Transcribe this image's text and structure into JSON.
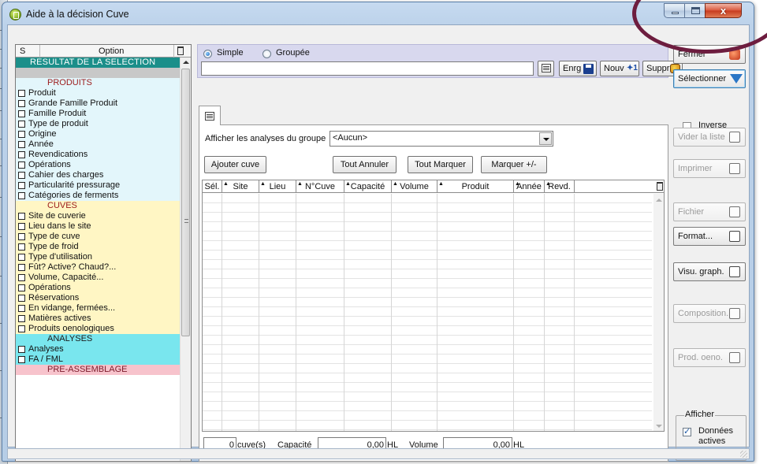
{
  "window": {
    "title": "Aide à la décision Cuve",
    "close_glyph": "x"
  },
  "options_panel": {
    "col_s": "S",
    "col_option": "Option",
    "rows": [
      {
        "label": "RESULTAT DE LA SELECTION",
        "kind": "selection-header"
      },
      {
        "label": "",
        "kind": "gray"
      },
      {
        "label": "PRODUITS",
        "kind": "section",
        "color": "#9b1b1b"
      },
      {
        "label": "Produit",
        "kind": "option"
      },
      {
        "label": "Grande Famille Produit",
        "kind": "option"
      },
      {
        "label": "Famille Produit",
        "kind": "option"
      },
      {
        "label": "Type de produit",
        "kind": "option"
      },
      {
        "label": "Origine",
        "kind": "option"
      },
      {
        "label": "Année",
        "kind": "option"
      },
      {
        "label": "Revendications",
        "kind": "option"
      },
      {
        "label": "Opérations",
        "kind": "option"
      },
      {
        "label": "Cahier des charges",
        "kind": "option"
      },
      {
        "label": "Particularité pressurage",
        "kind": "option"
      },
      {
        "label": "Catégories de ferments",
        "kind": "option"
      },
      {
        "label": "CUVES",
        "kind": "section",
        "color": "#9b1b1b"
      },
      {
        "label": "Site de cuverie",
        "kind": "option"
      },
      {
        "label": "Lieu dans le site",
        "kind": "option"
      },
      {
        "label": "Type de cuve",
        "kind": "option"
      },
      {
        "label": "Type de froid",
        "kind": "option"
      },
      {
        "label": "Type d'utilisation",
        "kind": "option"
      },
      {
        "label": "Fût? Active? Chaud?...",
        "kind": "option"
      },
      {
        "label": "Volume, Capacité...",
        "kind": "option"
      },
      {
        "label": "Opérations",
        "kind": "option"
      },
      {
        "label": "Réservations",
        "kind": "option"
      },
      {
        "label": "En vidange, fermées...",
        "kind": "option"
      },
      {
        "label": "Matières actives",
        "kind": "option"
      },
      {
        "label": "Produits oenologiques",
        "kind": "option"
      },
      {
        "label": "ANALYSES",
        "kind": "section",
        "color": "#1a1a1a"
      },
      {
        "label": "Analyses",
        "kind": "option"
      },
      {
        "label": "FA / FML",
        "kind": "option"
      },
      {
        "label": "PRE-ASSEMBLAGE",
        "kind": "section",
        "color": "#7a1a2a"
      }
    ]
  },
  "section_colors": {
    "produits": "#e3f6fb",
    "cuves": "#fff6c4",
    "analyses": "#79e6ee",
    "pre_assemblage": "#f7c3cc"
  },
  "mode": {
    "simple": "Simple",
    "groupee": "Groupée",
    "selected": "Simple",
    "name_value": "",
    "enrg": "Enrg",
    "nouv": "Nouv",
    "suppr": "Suppr"
  },
  "side_buttons": {
    "fermer": "Fermer",
    "selectionner": "Sélectionner",
    "inverse": "Inverse",
    "vider": "Vider la liste",
    "imprimer": "Imprimer",
    "fichier": "Fichier",
    "format": "Format...",
    "visu": "Visu. graph.",
    "composition": "Composition.",
    "prod_oeno": "Prod. oeno.",
    "afficher": "Afficher",
    "donnees_1": "Données",
    "donnees_2": "actives",
    "donnees_checked": true
  },
  "panel": {
    "afficher_label": "Afficher les analyses du groupe",
    "group_value": "<Aucun>",
    "ajouter": "Ajouter cuve",
    "tout_annuler": "Tout Annuler",
    "tout_marquer": "Tout Marquer",
    "marquer": "Marquer +/-"
  },
  "grid": {
    "columns": [
      "Sél.",
      "Site",
      "Lieu",
      "N°Cuve",
      "Capacité",
      "Volume",
      "Produit",
      "Année",
      "Revd."
    ],
    "rows": []
  },
  "totals": {
    "cuves_count": "0",
    "cuves_label": "cuve(s)",
    "capacite_label": "Capacité",
    "capacite_value": "0,00",
    "capacite_unit": "HL",
    "volume_label": "Volume",
    "volume_value": "0,00",
    "volume_unit": "HL"
  },
  "icons": [
    "app-icon",
    "trash-icon",
    "properties-icon",
    "save-icon",
    "new-icon",
    "delete-icon",
    "exit-icon",
    "funnel-icon",
    "erase-icon",
    "print-icon",
    "file-icon",
    "format-icon",
    "graph-icon",
    "composition-icon",
    "oeno-icon",
    "dropdown-arrow-icon"
  ]
}
